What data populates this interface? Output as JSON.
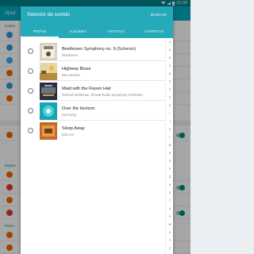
{
  "status": {
    "time": "10:00"
  },
  "background": {
    "appbar_title": "Ajust",
    "section_1": "Conex",
    "section_2": "Dispos",
    "section_3": "Perso"
  },
  "dialog": {
    "title": "Selector de sonido",
    "search_label": "BUSCAR",
    "tabs": [
      "PISTAS",
      "ÁLBUMES",
      "ARTISTAS",
      "CARPETAS"
    ],
    "tracks": [
      {
        "title": "Beethoven Symphony no. 9 (Scherzo)",
        "artist": "Beethoven"
      },
      {
        "title": "Highway Blues",
        "artist": "New Stories"
      },
      {
        "title": "Maid with the Flaxen Hair",
        "artist": "Richard Stoltzman, Slovak Radio Symphony Orchestra"
      },
      {
        "title": "Over the Horizon",
        "artist": "Samsung"
      },
      {
        "title": "Sleep Away",
        "artist": "Bob Acri"
      }
    ],
    "index_letters": [
      "#",
      "A",
      "B",
      "C",
      "D",
      "E",
      "F",
      "G",
      "H",
      "I",
      "J",
      "K",
      "L",
      "M",
      "N",
      "O",
      "P",
      "Q",
      "R",
      "S",
      "T",
      "U",
      "V",
      "W",
      "X",
      "Y",
      "Z"
    ]
  }
}
